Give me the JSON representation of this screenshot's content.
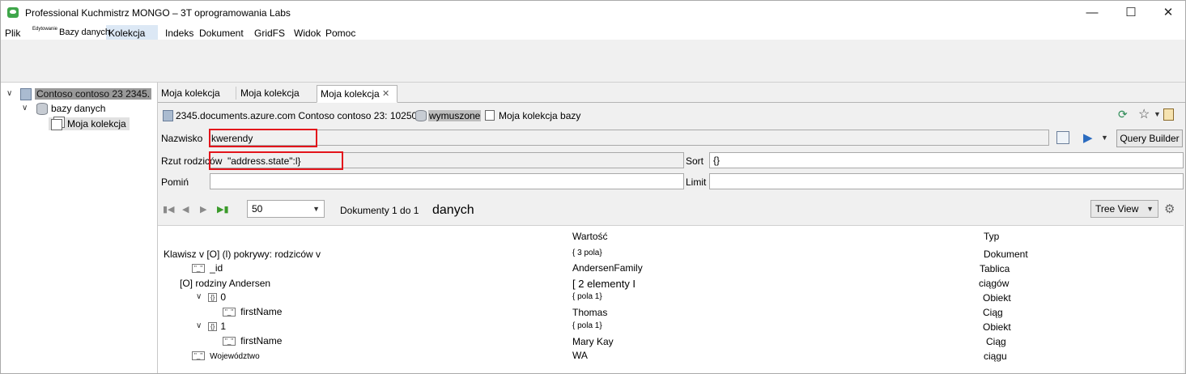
{
  "window": {
    "title": "Professional Kuchmistrz MONGO – 3T oprogramowania Labs",
    "minimize": "—",
    "maximize": "☐",
    "close": "✕"
  },
  "menu": {
    "file": "Plik",
    "edit_tiny": "Edytowanie",
    "databases": "Bazy danych",
    "collection": "Kolekcja",
    "index": "Indeks",
    "document": "Dokument",
    "gridfs": "GridFS",
    "view": "Widok",
    "help": "Pomoc"
  },
  "tree": {
    "server": "Contoso contoso 23 2345.",
    "databases": "bazy danych",
    "collection": "Moja kolekcja"
  },
  "tabs": [
    "Moja kolekcja",
    "Moja kolekcja",
    "Moja kolekcja"
  ],
  "path": {
    "server": "2345.documents.azure.com Contoso contoso 23: 10250",
    "db": "wymuszone",
    "collection": "Moja kolekcja bazy"
  },
  "query": {
    "name_label": "Nazwisko",
    "name_value": "kwerendy",
    "projection_label": "Rzut rodziców",
    "projection_value": "\"address.state\":l}",
    "sort_label": "Sort",
    "sort_value": "{}",
    "skip_label": "Pomiń",
    "skip_value": "",
    "limit_label": "Limit",
    "limit_value": "",
    "query_builder": "Query Builder"
  },
  "pager": {
    "page_size": "50",
    "documents": "Dokumenty 1 do 1",
    "data_label": "danych",
    "view_mode": "Tree View"
  },
  "grid": {
    "headers": {
      "value": "Wartość",
      "type": "Typ"
    },
    "rows": [
      {
        "key": "Klawisz v [O] (l) pokrywy: rodziców v",
        "value": "{ 3 pola}",
        "type": "Dokument"
      },
      {
        "key": "_id",
        "value": "AndersenFamily",
        "type": "Tablica"
      },
      {
        "key": "[O] rodziny Andersen",
        "value": "[ 2 elementy I",
        "type": "ciągów"
      },
      {
        "key": "0",
        "value": "{ pola 1}",
        "type": "Obiekt"
      },
      {
        "key": "firstName",
        "value": "Thomas",
        "type": "Ciąg"
      },
      {
        "key": "1",
        "value": "{ pola 1}",
        "type": "Obiekt"
      },
      {
        "key": "firstName",
        "value": "Mary Kay",
        "type": "Ciąg"
      },
      {
        "key": "Województwo",
        "value": "WA",
        "type": "ciągu"
      }
    ]
  }
}
